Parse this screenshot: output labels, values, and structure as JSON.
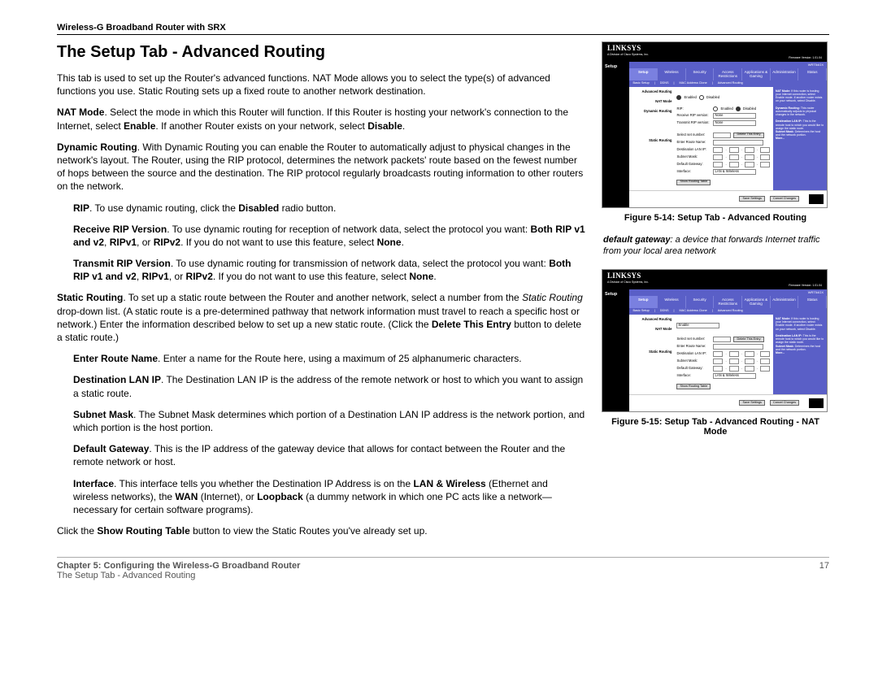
{
  "header": {
    "product": "Wireless-G Broadband Router with SRX"
  },
  "title": "The Setup Tab - Advanced Routing",
  "paras": {
    "intro": "This tab is used to set up the Router's advanced functions. NAT Mode allows you to select the type(s) of advanced functions you use. Static Routing sets up a fixed route to another network destination.",
    "nat_label": "NAT Mode",
    "nat_text_a": ". Select the mode in which this Router will function. If this Router is hosting your network's connection to the Internet, select ",
    "nat_enable": "Enable",
    "nat_text_b": ". If another Router exists on your network, select ",
    "nat_disable": "Disable",
    "nat_text_c": ".",
    "dyn_label": "Dynamic Routing",
    "dyn_text": ". With Dynamic Routing you can enable the Router to automatically adjust to physical changes in the network's layout. The Router, using the RIP protocol, determines the network packets' route based on the fewest number of hops between the source and the destination. The RIP protocol regularly broadcasts routing information to other routers on the network.",
    "rip_label": "RIP",
    "rip_text_a": ". To use dynamic routing, click the ",
    "rip_disabled": "Disabled",
    "rip_text_b": " radio button.",
    "recv_label": "Receive RIP Version",
    "recv_text_a": ". To use dynamic routing for reception of network data, select the protocol you want: ",
    "protocols_both": "Both RIP v1 and v2",
    "protocols_sep1": ", ",
    "protocols_v1": "RIPv1",
    "protocols_sep2": ", or ",
    "protocols_v2": "RIPv2",
    "recv_text_b": ". If you do not want to use this feature, select ",
    "none": "None",
    "period": ".",
    "trans_label": "Transmit RIP Version",
    "trans_text_a": ". To use dynamic routing for transmission of network data, select the protocol you want: ",
    "trans_text_b": ". If you do not want to use this feature, select ",
    "static_label": "Static Routing",
    "static_text_a": ". To set up a static route between the Router and another network, select a number from the ",
    "static_italic": "Static Routing",
    "static_text_b": " drop-down list. (A static route is a pre-determined pathway that network information must travel to reach a specific host or network.) Enter the information described below to set up a new static route. (Click the ",
    "delete_entry": "Delete This Entry",
    "static_text_c": " button to delete a static route.)",
    "route_label": "Enter Route Name",
    "route_text": ". Enter a name for the Route here, using a maximum of 25 alphanumeric characters.",
    "dest_label": "Destination LAN IP",
    "dest_text": ". The Destination LAN IP is the address of the remote network or host to which you want to assign a static route.",
    "subnet_label": "Subnet Mask",
    "subnet_text": ". The Subnet Mask determines which portion of a Destination LAN IP address is the network portion, and which portion is the host portion.",
    "gw_label": "Default Gateway",
    "gw_text": ". This is the IP address of the gateway device that allows for contact between the Router and the remote network or host.",
    "iface_label": "Interface",
    "iface_text_a": ". This interface tells you whether the Destination IP Address is on the ",
    "iface_lan": "LAN & Wireless",
    "iface_text_b": " (Ethernet and wireless networks), the ",
    "iface_wan": "WAN",
    "iface_text_c": " (Internet), or ",
    "iface_loop": "Loopback",
    "iface_text_d": " (a dummy network in which one PC acts like a network—necessary for certain software programs).",
    "showtable_a": "Click the ",
    "showtable_b": "Show Routing Table",
    "showtable_c": " button to view the Static Routes you've already set up."
  },
  "sidebar": {
    "fig14": "Figure 5-14: Setup Tab - Advanced Routing",
    "fig15": "Figure 5-15: Setup Tab - Advanced Routing - NAT Mode",
    "glossary_term": "default gateway",
    "glossary_def": ": a device that forwards Internet traffic from your local area network"
  },
  "footer": {
    "chapter": "Chapter 5: Configuring the Wireless-G Broadband Router",
    "section": "The Setup Tab - Advanced Routing",
    "page": "17"
  },
  "router": {
    "brand": "LINKSYS",
    "division": "A Division of Cisco Systems, Inc.",
    "fw": "Firmware Version: 1.01.04",
    "model": "WRT54GX",
    "setup": "Setup",
    "tabs": [
      "Setup",
      "Wireless",
      "Security",
      "Access Restrictions",
      "Applications & Gaming",
      "Administration",
      "Status"
    ],
    "subtabs": [
      "Basic Setup",
      "DDNS",
      "MAC Address Clone",
      "Advanced Routing"
    ],
    "nav": {
      "adv": "Advanced Routing",
      "nat": "NAT Mode",
      "dyn": "Dynamic Routing",
      "static": "Static Routing"
    },
    "form": {
      "nat_enable": "Enable",
      "nat_disable": "Disable",
      "enabled": "Enabled",
      "disabled": "Disabled",
      "rip": "RIP:",
      "recv": "Receive RIP version:",
      "trans": "Transmit RIP version:",
      "sel_none": "None",
      "select_set": "Select set number:",
      "delete": "Delete This Entry",
      "route_name": "Enter Route Name:",
      "dest_ip": "Destination LAN IP:",
      "subnet": "Subnet Mask:",
      "gateway": "Default Gateway:",
      "interface": "Interface:",
      "iface_val": "LAN & Wireless",
      "show_table": "Show Routing Table",
      "save": "Save Settings",
      "cancel": "Cancel Changes"
    },
    "help": {
      "nat_h": "NAT Mode:",
      "nat_t": " If this router is hosting your Internet connection, select Enable mode. If another router exists on your network, select Disable.",
      "dyn_h": "Dynamic Routing:",
      "dyn_t": " This router automatically adjusts to physical changes in the network.",
      "dest_h": "Destination LAN IP:",
      "dest_t": " This is the remote host to which you would like to assign the static route.",
      "sub_h": "Subnet Mask:",
      "sub_t": " Determines the host and the network portion.",
      "more": "More..."
    }
  }
}
